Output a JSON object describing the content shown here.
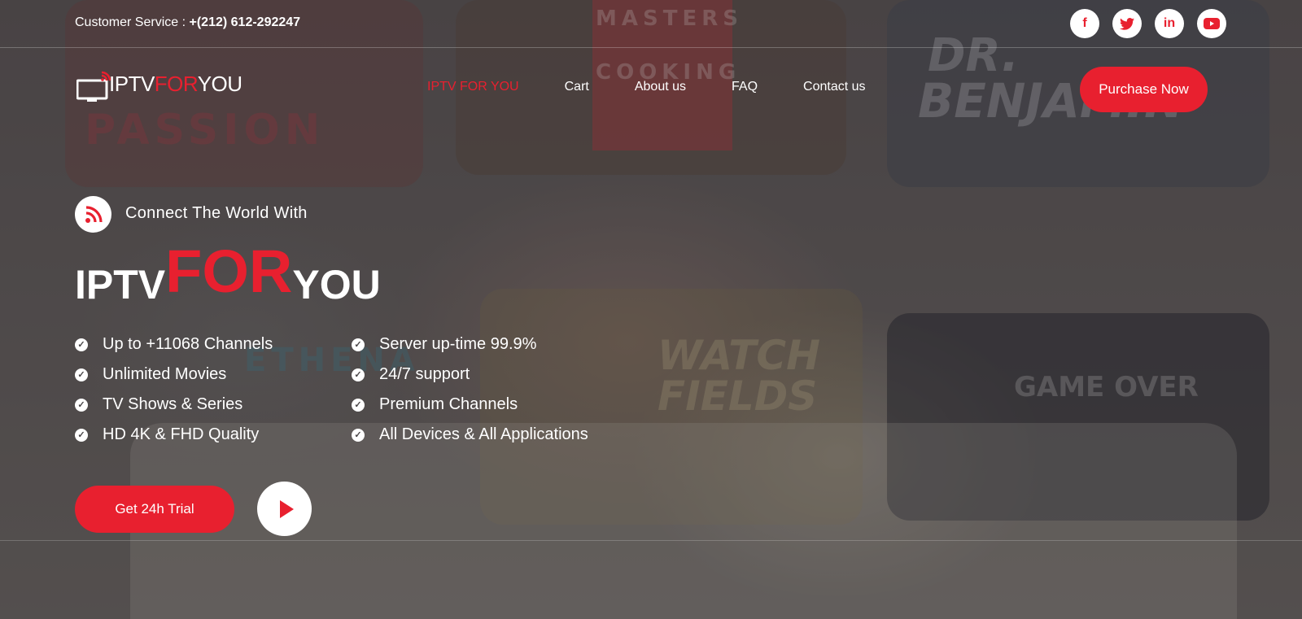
{
  "topbar": {
    "customer_service_label": "Customer Service :",
    "phone": "+(212) 612-292247",
    "socials": [
      {
        "name": "facebook",
        "glyph": "f"
      },
      {
        "name": "twitter",
        "glyph": "t"
      },
      {
        "name": "linkedin",
        "glyph": "in"
      },
      {
        "name": "youtube",
        "glyph": "▶"
      }
    ]
  },
  "logo": {
    "part1": "IPTV",
    "part2": "FOR",
    "part3": "YOU"
  },
  "nav": {
    "items": [
      {
        "label": "IPTV FOR YOU",
        "active": true
      },
      {
        "label": "Cart",
        "active": false
      },
      {
        "label": "About us",
        "active": false
      },
      {
        "label": "FAQ",
        "active": false
      },
      {
        "label": "Contact us",
        "active": false
      }
    ],
    "cta": "Purchase Now"
  },
  "hero": {
    "tagline": "Connect The World With",
    "title_part1": "IPTV",
    "title_part2": "FOR",
    "title_part3": "YOU",
    "features_left": [
      "Up to +11068 Channels",
      "Unlimited Movies",
      "TV Shows & Series",
      "HD 4K & FHD Quality"
    ],
    "features_right": [
      "Server up-time 99.9%",
      "24/7 support",
      "Premium Channels",
      "All Devices & All Applications"
    ],
    "trial_button": "Get 24h Trial"
  },
  "background_posters": {
    "p1": "PASSION",
    "p2a": "MASTERS",
    "p2b": "COOKING",
    "p3a": "DR.",
    "p3b": "BENJAMIN",
    "p4": "GAME OVER",
    "p5a": "WATCH",
    "p5b": "FIELDS",
    "p6": "ETHENA"
  },
  "colors": {
    "accent": "#e8202f",
    "white": "#ffffff"
  }
}
